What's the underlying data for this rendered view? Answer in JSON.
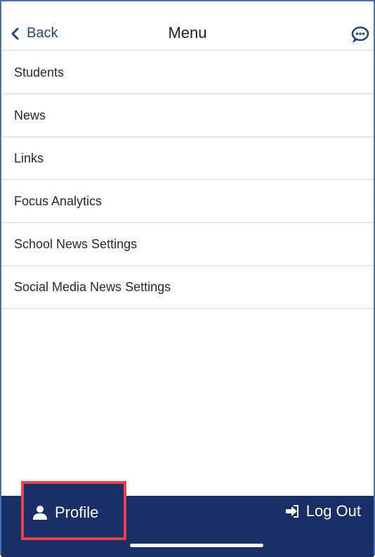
{
  "header": {
    "back_label": "Back",
    "title": "Menu",
    "chat_icon": "chat-bubble-icon"
  },
  "menu": {
    "items": [
      {
        "label": "Students"
      },
      {
        "label": "News"
      },
      {
        "label": "Links"
      },
      {
        "label": "Focus Analytics"
      },
      {
        "label": "School News Settings"
      },
      {
        "label": "Social Media News Settings"
      }
    ]
  },
  "footer": {
    "profile_label": "Profile",
    "logout_label": "Log Out",
    "background": "#1a2f66",
    "highlight": "#e8424b"
  },
  "colors": {
    "accent": "#24427a",
    "divider": "#d9d9d9"
  }
}
